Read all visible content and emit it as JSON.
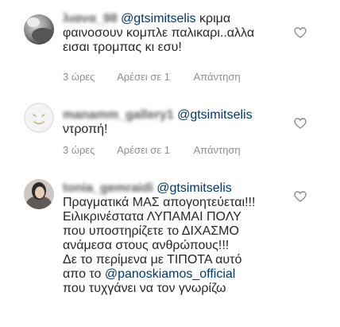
{
  "comments": [
    {
      "username": "λιανα_98",
      "mention": "@gtsimitselis",
      "lines": [
        "κριμα",
        "φαινοσουν κομπλε παλικαρι..αλλα",
        "εισαι τρομπας κι εσυ!"
      ],
      "time": "3 ώρες",
      "likes": "Αρέσει σε 1",
      "reply": "Απάντηση",
      "avatar": "avatar-grey-photo"
    },
    {
      "username": "manamm_gallery1",
      "mention": "@gtsimitselis",
      "lines": [
        "ντροπή!"
      ],
      "time": "3 ώρες",
      "likes": "Αρέσει σε 1",
      "reply": "Απάντηση",
      "avatar": "avatar-face-illustration"
    },
    {
      "username": "tonia_gemraidi",
      "mention": "@gtsimitselis",
      "lines": [
        "Πραγματικά ΜΑΣ απογοητεύεται!!!",
        "Ειλικρινέστατα ΛΥΠΑΜΑΙ ΠΟΛΥ",
        "που υποστηρίζετε το ΔΙΧΑΣΜΟ",
        "ανάμεσα στους ανθρώπους!!!",
        "Δε το περίμενα με ΤΙΠΟΤΑ αυτό",
        "απο το"
      ],
      "mention2": "@panoskiamos_official",
      "last_line": "που τυχγάνει να τον γνωρίζω",
      "avatar": "avatar-woman-photo"
    }
  ],
  "icons": {
    "like": "heart-outline-icon"
  },
  "colors": {
    "text": "#262626",
    "mention": "#00376b",
    "meta": "#8e8e8e"
  }
}
